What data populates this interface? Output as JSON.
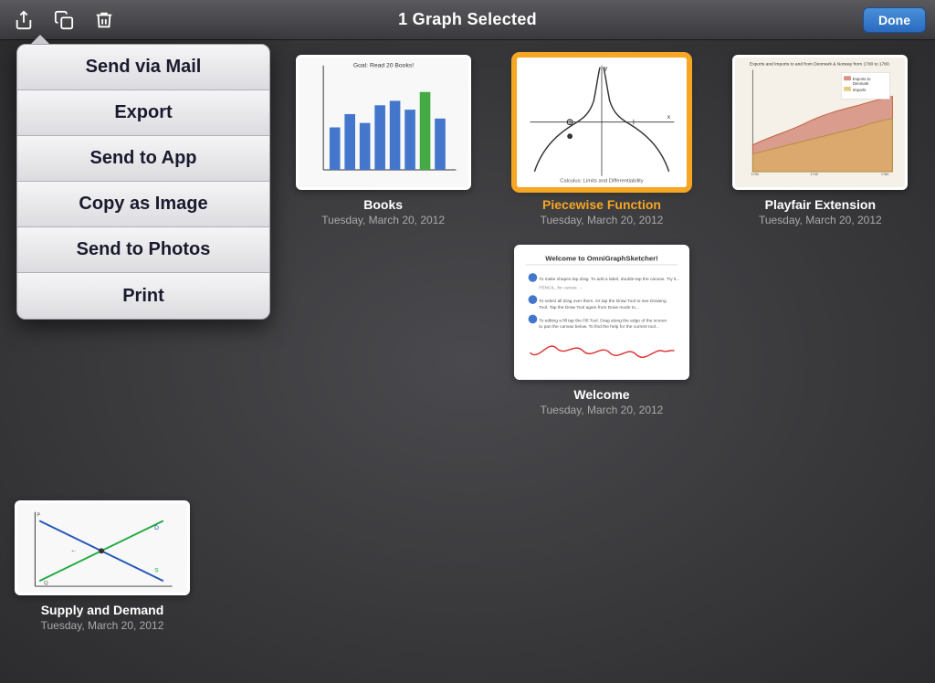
{
  "topbar": {
    "title": "1 Graph Selected",
    "done_label": "Done"
  },
  "menu": {
    "items": [
      {
        "label": "Send via Mail",
        "id": "send-via-mail"
      },
      {
        "label": "Export",
        "id": "export"
      },
      {
        "label": "Send to App",
        "id": "send-to-app"
      },
      {
        "label": "Copy as Image",
        "id": "copy-as-image"
      },
      {
        "label": "Send to Photos",
        "id": "send-to-photos"
      },
      {
        "label": "Print",
        "id": "print"
      }
    ]
  },
  "graphs": [
    {
      "id": "books",
      "name": "Books",
      "date": "Tuesday, March 20, 2012",
      "selected": false
    },
    {
      "id": "piecewise",
      "name": "Piecewise Function",
      "date": "Tuesday, March 20, 2012",
      "selected": true
    },
    {
      "id": "playfair",
      "name": "Playfair Extension",
      "date": "Tuesday, March 20, 2012",
      "selected": false
    },
    {
      "id": "supply-demand",
      "name": "Supply and Demand",
      "date": "Tuesday, March 20, 2012",
      "selected": false
    },
    {
      "id": "welcome",
      "name": "Welcome",
      "date": "Tuesday, March 20, 2012",
      "selected": false
    }
  ]
}
